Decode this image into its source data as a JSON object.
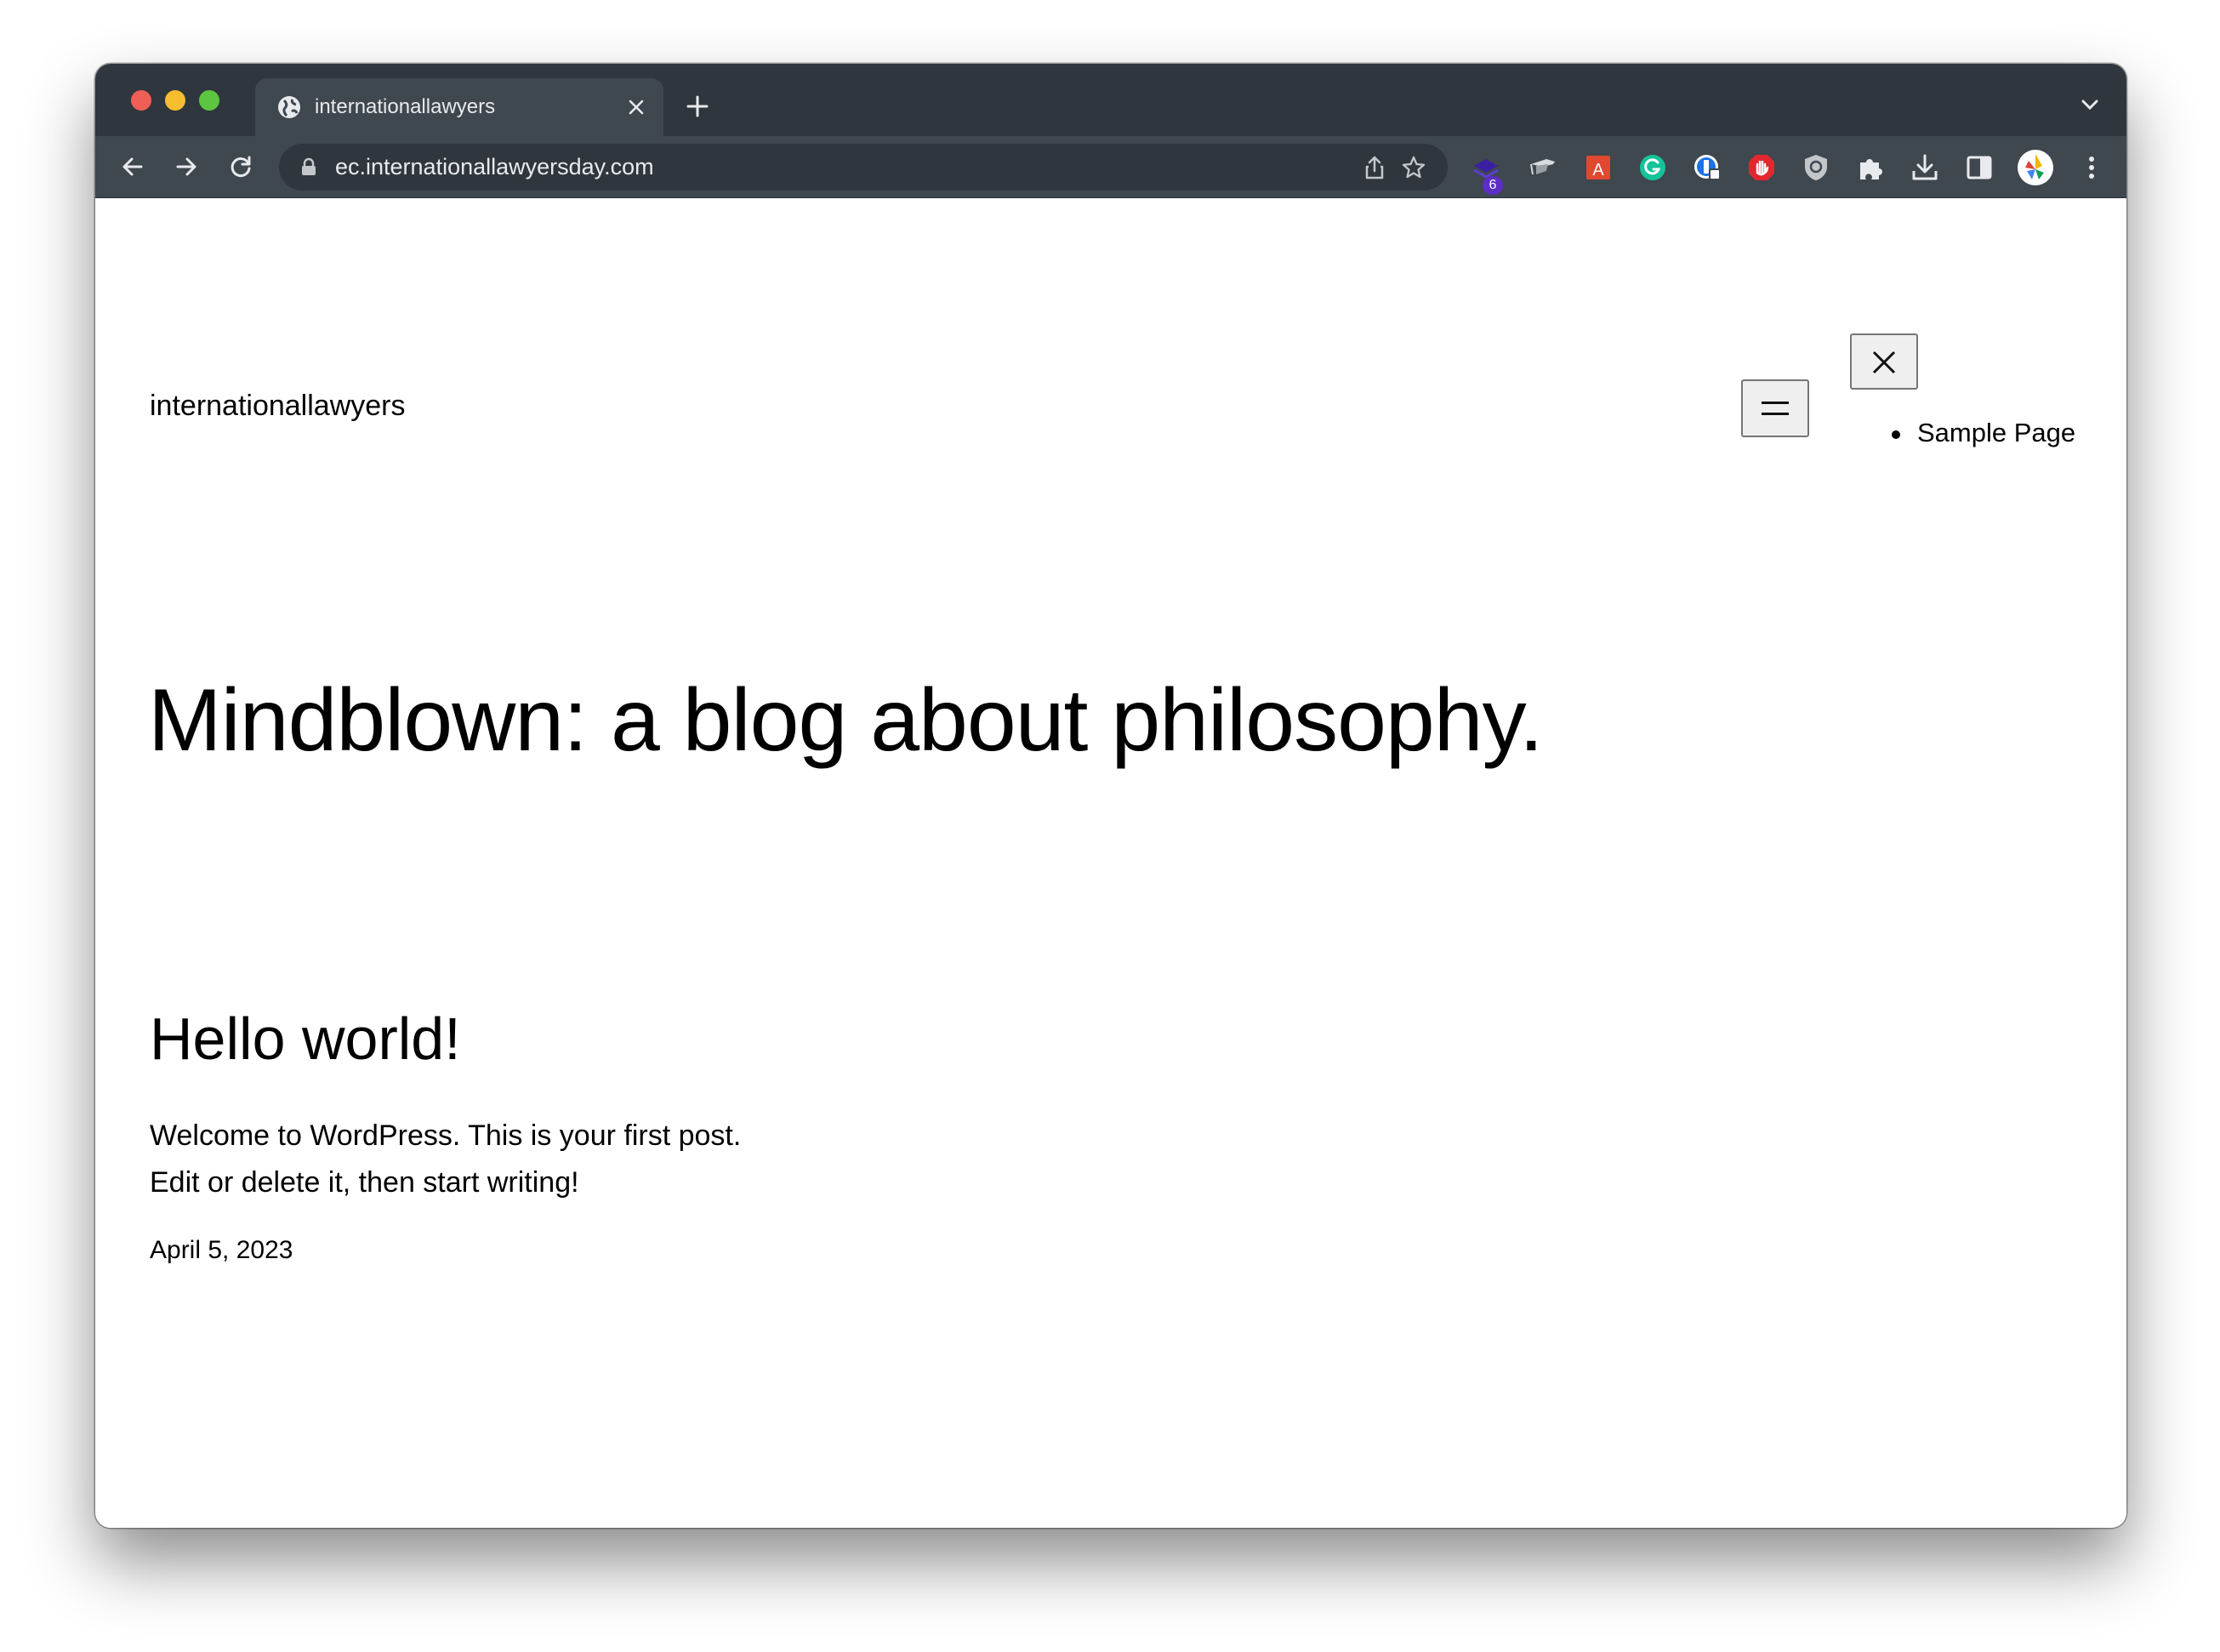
{
  "browser": {
    "tab": {
      "title": "internationallawyers",
      "favicon": "globe-icon"
    },
    "toolbar": {
      "url": "ec.internationallawyersday.com",
      "extension_badge": "6",
      "extensions": [
        "stack-extension-icon",
        "cap-extension-icon",
        "acrobat-extension-icon",
        "grammarly-extension-icon",
        "password-manager-extension-icon",
        "adblock-extension-icon",
        "shield-extension-icon",
        "puzzle-icon",
        "download-icon",
        "side-panel-icon",
        "profile-avatar",
        "kebab-menu-icon"
      ]
    }
  },
  "site": {
    "title": "internationallawyers",
    "menu": {
      "items": [
        {
          "label": "Sample Page"
        }
      ]
    }
  },
  "hero": {
    "title": "Mindblown: a blog about philosophy."
  },
  "post": {
    "title": "Hello world!",
    "excerpt": "Welcome to WordPress. This is your first post. Edit or delete it, then start writing!",
    "date": "April 5, 2023"
  },
  "colors": {
    "tabstrip": "#30363d",
    "toolbar": "#3f474f",
    "omnibox": "#30363d",
    "browser_text": "#e8eaed",
    "badge": "#5b2fc4"
  }
}
